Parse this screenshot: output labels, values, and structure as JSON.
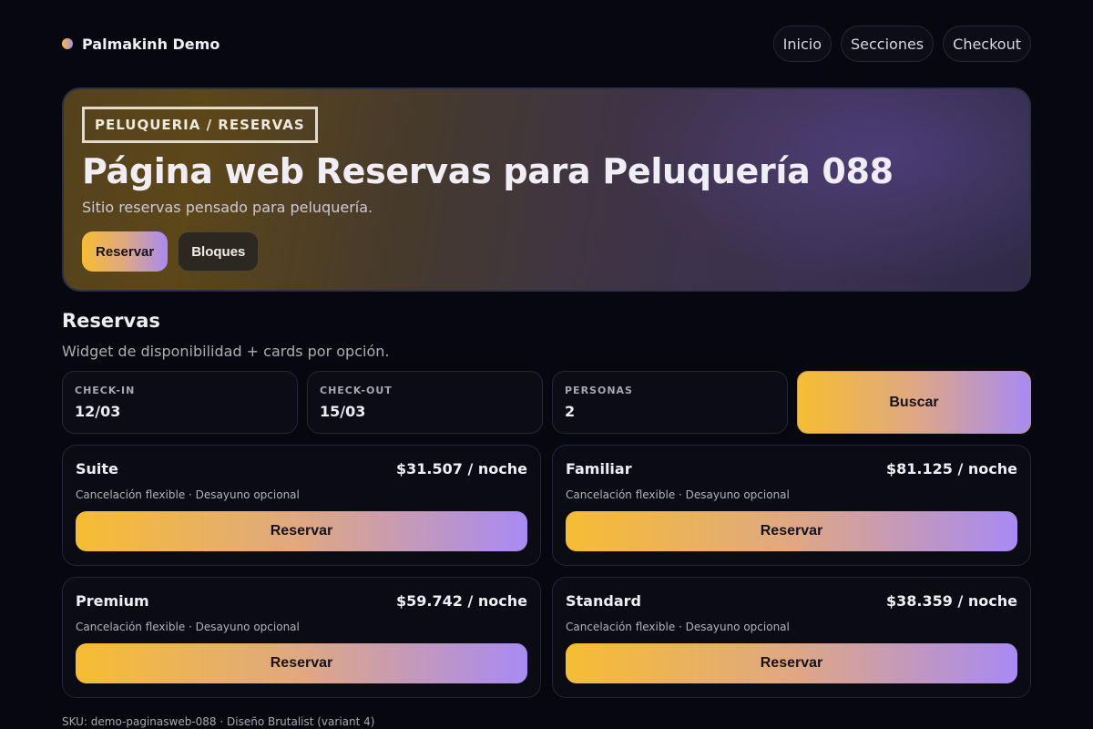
{
  "brand": {
    "name": "Palmakinh Demo"
  },
  "nav": {
    "items": [
      "Inicio",
      "Secciones",
      "Checkout"
    ]
  },
  "hero": {
    "tag": "PELUQUERIA / RESERVAS",
    "title": "Página web Reservas para Peluquería 088",
    "subtitle": "Sitio reservas pensado para peluquería.",
    "primary_button": "Reservar",
    "secondary_button": "Bloques"
  },
  "section": {
    "title": "Reservas",
    "subtitle": "Widget de disponibilidad + cards por opción."
  },
  "widget": {
    "fields": [
      {
        "label": "CHECK-IN",
        "value": "12/03"
      },
      {
        "label": "CHECK-OUT",
        "value": "15/03"
      },
      {
        "label": "PERSONAS",
        "value": "2"
      }
    ],
    "search_button": "Buscar"
  },
  "cards": [
    {
      "name": "Suite",
      "price": "$31.507 / noche",
      "note": "Cancelación flexible · Desayuno opcional",
      "button": "Reservar"
    },
    {
      "name": "Familiar",
      "price": "$81.125 / noche",
      "note": "Cancelación flexible · Desayuno opcional",
      "button": "Reservar"
    },
    {
      "name": "Premium",
      "price": "$59.742 / noche",
      "note": "Cancelación flexible · Desayuno opcional",
      "button": "Reservar"
    },
    {
      "name": "Standard",
      "price": "$38.359 / noche",
      "note": "Cancelación flexible · Desayuno opcional",
      "button": "Reservar"
    }
  ],
  "footer": {
    "text": "SKU: demo-paginasweb-088 · Diseño Brutalist (variant 4)"
  },
  "colors": {
    "background": "#07080f",
    "accent_start": "#f6bd32",
    "accent_end": "#a88af3"
  }
}
